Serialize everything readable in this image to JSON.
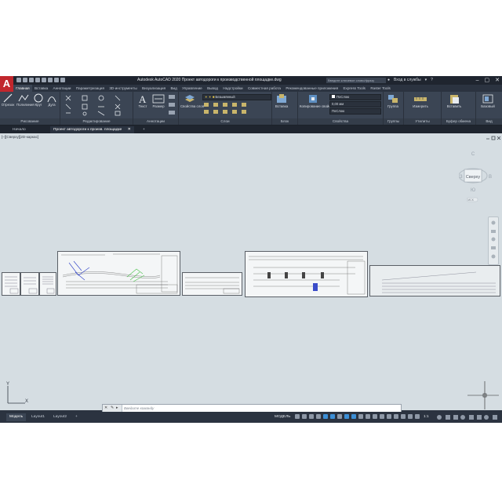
{
  "window": {
    "title": "Autodesk AutoCAD 2020   Проект автодороги к производственной площадке.dwg",
    "search_placeholder": "Введите ключевое слово/фразу",
    "signin": "Вход в службы",
    "logo": "A",
    "win_min": "–",
    "win_max": "▢",
    "win_close": "✕"
  },
  "ribbon_tabs": [
    "Главная",
    "Вставка",
    "Аннотации",
    "Параметризация",
    "3D-инструменты",
    "Визуализация",
    "Вид",
    "Управление",
    "Вывод",
    "Надстройки",
    "Совместная работа",
    "Рекомендованные приложения",
    "Express Tools",
    "Raster Tools"
  ],
  "ribbon": {
    "draw": {
      "title": "Рисование",
      "line": "Отрезок",
      "polyline": "Полилиния",
      "circle": "Круг",
      "arc": "Дуга"
    },
    "modify": {
      "title": "Редактирование"
    },
    "annotation": {
      "title": "Аннотации",
      "text": "Текст",
      "dimension": "Размер"
    },
    "layers": {
      "title": "Слои",
      "layer_props": "Свойства слоя",
      "current_layer": "Безымянный"
    },
    "block": {
      "title": "Блок",
      "insert": "Вставка"
    },
    "properties": {
      "title": "Свойства",
      "match": "Копирование свойств",
      "color": "ПоСлою",
      "lineweight": "0,00 мм",
      "linetype": "ПоСлою"
    },
    "groups": {
      "title": "Группы",
      "group": "Группа"
    },
    "utilities": {
      "title": "Утилиты",
      "measure": "Измерить"
    },
    "clipboard": {
      "title": "Буфер обмена",
      "paste": "Вставить"
    },
    "view": {
      "title": "Вид",
      "base": "Базовый"
    }
  },
  "doc_tabs": [
    {
      "label": "Начало",
      "active": false
    },
    {
      "label": "Проект автодороги к произв. площадке",
      "active": true
    }
  ],
  "viewport_label": "[–][Сверху][2D-каркас]",
  "viewcube": {
    "face": "Сверху",
    "north": "С",
    "south": "Ю",
    "east": "В",
    "west": "З",
    "ucs": "МСК"
  },
  "ucs_icon": {
    "x_label": "X",
    "y_label": "Y"
  },
  "command": {
    "placeholder": "Введите команду"
  },
  "layout_tabs": [
    {
      "label": "Модель",
      "active": true
    },
    {
      "label": "Layout1",
      "active": false
    },
    {
      "label": "Layout2",
      "active": false
    }
  ],
  "status": {
    "model": "МОДЕЛЬ",
    "scale": "1:1"
  },
  "colors": {
    "accent": "#3d8fd6",
    "logo_red": "#c1272d",
    "ribbon_bg": "#3b4554",
    "canvas_bg": "#d5dde2"
  }
}
